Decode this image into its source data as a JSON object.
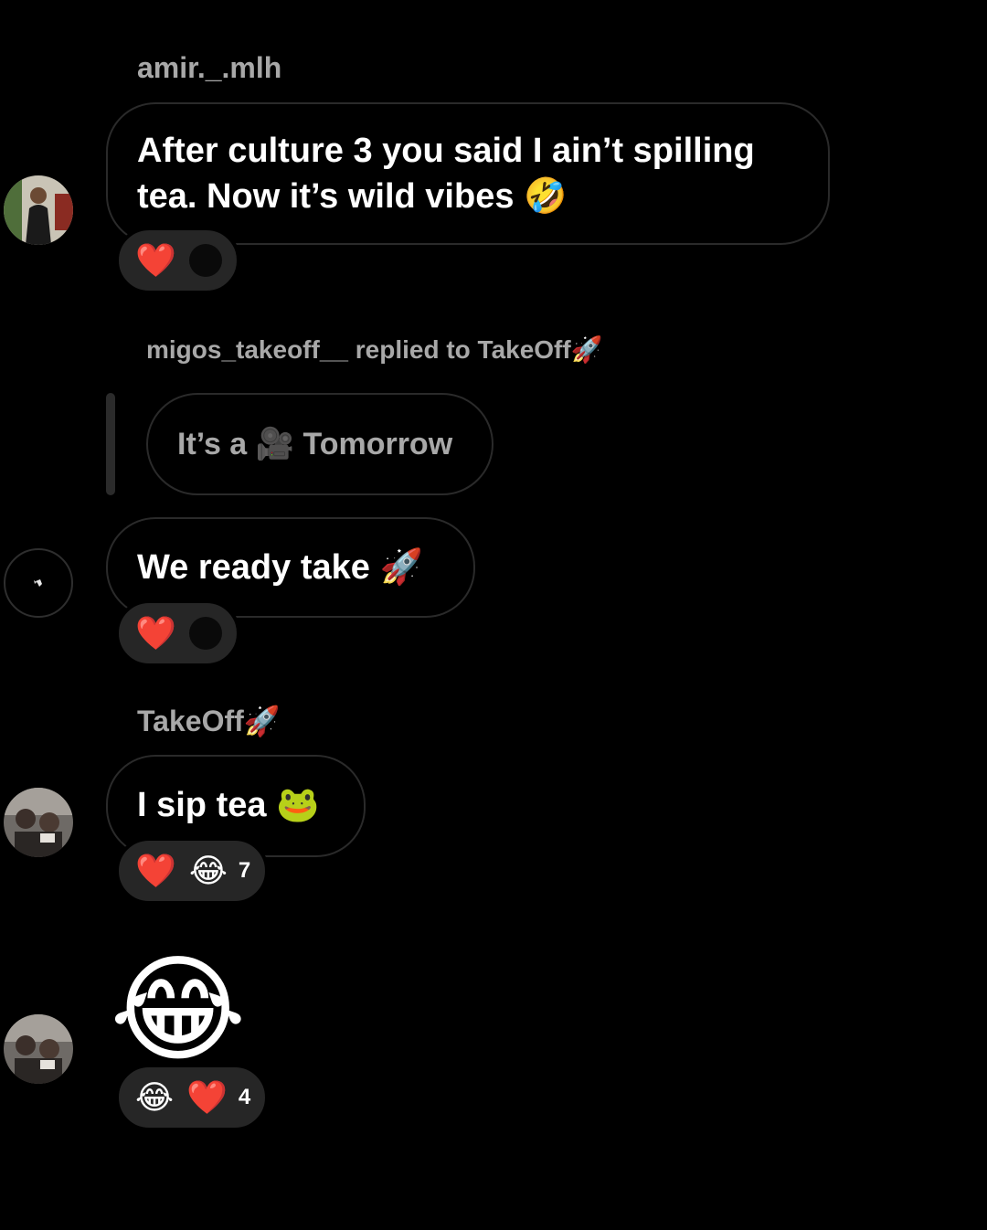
{
  "messages": [
    {
      "sender": "amir._.mlh",
      "text_line1": "After culture 3 you said I ain’t spilling",
      "text_line2": "tea. Now it’s wild vibes 🤣",
      "reactions": [
        "❤️"
      ]
    },
    {
      "reply_header": "migos_takeoff__ replied to TakeOff🚀",
      "quoted_text": "It’s a 🎥 Tomorrow",
      "text": "We ready take 🚀",
      "reactions": [
        "❤️"
      ]
    },
    {
      "sender": "TakeOff🚀",
      "text": "I sip tea 🐸",
      "reactions": [
        "❤️",
        "😂"
      ],
      "reaction_count": "7"
    },
    {
      "emoji": "😂",
      "reactions": [
        "😂",
        "❤️"
      ],
      "reaction_count": "4"
    }
  ],
  "icons": {
    "avatar_1": "avatar-photo",
    "avatar_2": "bird-avatar-icon",
    "avatar_3": "avatar-photo",
    "avatar_4": "avatar-photo"
  }
}
